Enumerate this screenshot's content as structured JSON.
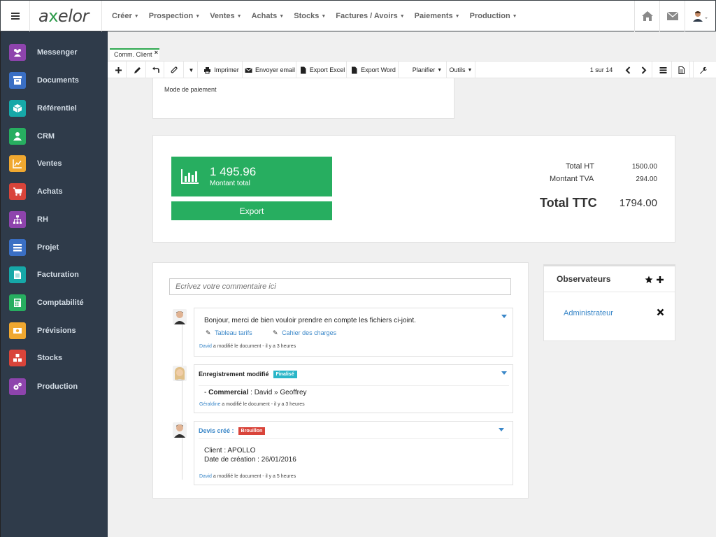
{
  "brand": {
    "logo_pre": "a",
    "logo_x": "x",
    "logo_post": "elor"
  },
  "top_menu": [
    {
      "label": "Créer"
    },
    {
      "label": "Prospection"
    },
    {
      "label": "Ventes"
    },
    {
      "label": "Achats"
    },
    {
      "label": "Stocks"
    },
    {
      "label": "Factures / Avoirs"
    },
    {
      "label": "Paiements"
    },
    {
      "label": "Production"
    }
  ],
  "top_icons": [
    "home-icon",
    "envelope-icon",
    "user-avatar"
  ],
  "sidebar": {
    "items": [
      {
        "label": "Messenger",
        "color": "#8e44ad",
        "icon": "users-icon"
      },
      {
        "label": "Documents",
        "color": "#3a6fc4",
        "icon": "archive-icon"
      },
      {
        "label": "Référentiel",
        "color": "#16a8a8",
        "icon": "cube-icon"
      },
      {
        "label": "CRM",
        "color": "#27ae60",
        "icon": "user-icon"
      },
      {
        "label": "Ventes",
        "color": "#f0a830",
        "icon": "line-chart-icon"
      },
      {
        "label": "Achats",
        "color": "#d9443a",
        "icon": "cart-icon"
      },
      {
        "label": "RH",
        "color": "#8e44ad",
        "icon": "org-chart-icon"
      },
      {
        "label": "Projet",
        "color": "#3a6fc4",
        "icon": "tasks-icon"
      },
      {
        "label": "Facturation",
        "color": "#16a8a8",
        "icon": "file-icon"
      },
      {
        "label": "Comptabilité",
        "color": "#27ae60",
        "icon": "calculator-icon"
      },
      {
        "label": "Prévisions",
        "color": "#f0a830",
        "icon": "money-icon"
      },
      {
        "label": "Stocks",
        "color": "#d9443a",
        "icon": "cubes-icon"
      },
      {
        "label": "Production",
        "color": "#8e44ad",
        "icon": "cogs-icon"
      }
    ]
  },
  "tab": {
    "label": "Comm. Client",
    "close": "×"
  },
  "toolbar": {
    "print": "Imprimer",
    "email": "Envoyer email",
    "excel": "Export Excel",
    "word": "Export Word",
    "plan": "Planifier",
    "tools": "Outils",
    "pager": "1 sur 14"
  },
  "form": {
    "payment_mode_label": "Mode de paiement"
  },
  "totals": {
    "amount": "1 495.96",
    "amount_label": "Montant total",
    "export": "Export",
    "ht_label": "Total HT",
    "ht_value": "1500.00",
    "tva_label": "Montant TVA",
    "tva_value": "294.00",
    "ttc_label": "Total TTC",
    "ttc_value": "1794.00"
  },
  "comments": {
    "placeholder": "Ecrivez votre commentaire ici",
    "messages": [
      {
        "text": "Bonjour, merci de bien vouloir prendre en compte les fichiers ci-joint.",
        "attachments": [
          "Tableau tarifs",
          "Cahier des charges"
        ],
        "author": "David",
        "meta": " a modifié le document - il y a 3 heures"
      },
      {
        "title": "Enregistrement modifié",
        "badge": "Finalisé",
        "badge_color": "#2ab6c8",
        "change_prefix": "- ",
        "field": "Commercial",
        "change_value": " : David » Geoffrey",
        "author": "Géraldine",
        "meta": " a modifié le document - il y a 3 heures"
      },
      {
        "title": "Devis créé :",
        "badge": "Brouillon",
        "badge_color": "#d9443a",
        "line1": "Client : APOLLO",
        "line2": "Date de création : 26/01/2016",
        "author": "David",
        "meta": " a modifié le document - il y a 5 heures"
      }
    ]
  },
  "observers": {
    "title": "Observateurs",
    "user": "Administrateur"
  }
}
